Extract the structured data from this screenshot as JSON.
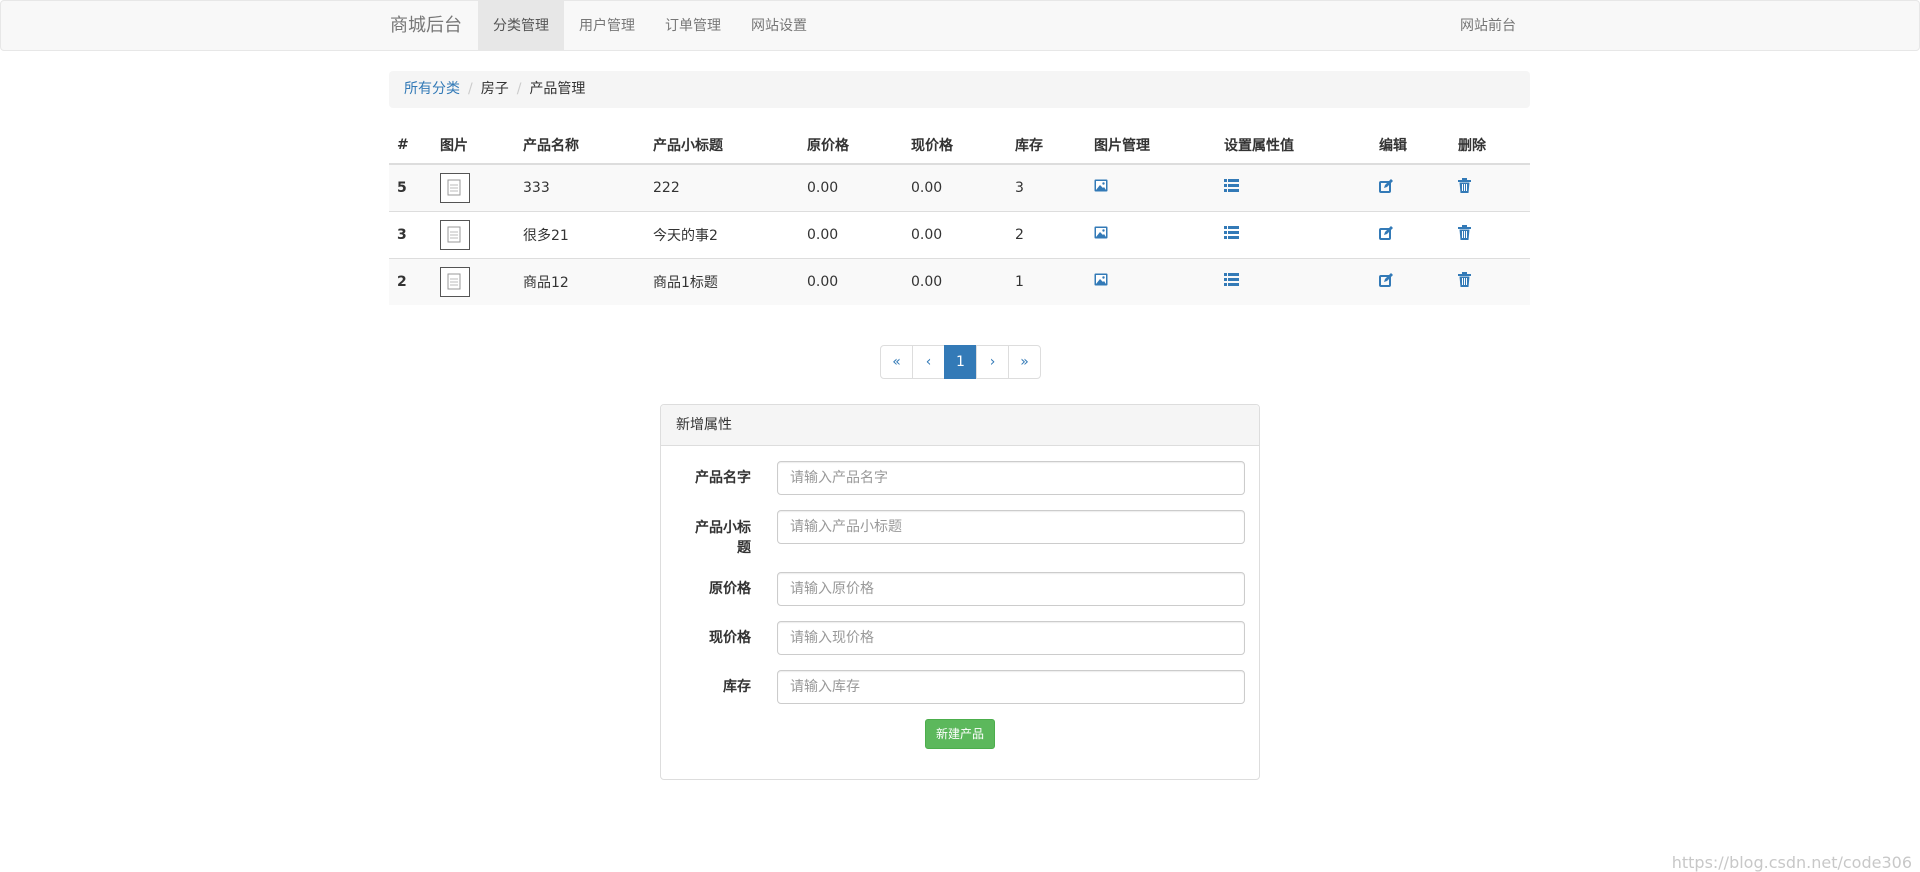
{
  "navbar": {
    "brand": "商城后台",
    "items": [
      {
        "label": "分类管理",
        "active": true
      },
      {
        "label": "用户管理",
        "active": false
      },
      {
        "label": "订单管理",
        "active": false
      },
      {
        "label": "网站设置",
        "active": false
      }
    ],
    "right_link": "网站前台"
  },
  "breadcrumb": {
    "items": [
      "所有分类",
      "房子",
      "产品管理"
    ]
  },
  "table": {
    "headers": [
      "#",
      "图片",
      "产品名称",
      "产品小标题",
      "原价格",
      "现价格",
      "库存",
      "图片管理",
      "设置属性值",
      "编辑",
      "删除"
    ],
    "rows": [
      {
        "id": "5",
        "name": "333",
        "subtitle": "222",
        "orig_price": "0.00",
        "price": "0.00",
        "stock": "3"
      },
      {
        "id": "3",
        "name": "很多21",
        "subtitle": "今天的事2",
        "orig_price": "0.00",
        "price": "0.00",
        "stock": "2"
      },
      {
        "id": "2",
        "name": "商品12",
        "subtitle": "商品1标题",
        "orig_price": "0.00",
        "price": "0.00",
        "stock": "1"
      }
    ]
  },
  "pagination": {
    "first": "«",
    "prev": "‹",
    "current": "1",
    "next": "›",
    "last": "»"
  },
  "form": {
    "title": "新增属性",
    "fields": [
      {
        "label": "产品名字",
        "placeholder": "请输入产品名字"
      },
      {
        "label_line1": "产品小标",
        "label_line2": "题",
        "placeholder": "请输入产品小标题"
      },
      {
        "label": "原价格",
        "placeholder": "请输入原价格"
      },
      {
        "label": "现价格",
        "placeholder": "请输入现价格"
      },
      {
        "label": "库存",
        "placeholder": "请输入库存"
      }
    ],
    "submit_label": "新建产品"
  },
  "watermark": "https://blog.csdn.net/code306",
  "colors": {
    "link": "#337ab7",
    "success": "#5cb85c",
    "nav_bg": "#f8f8f8"
  }
}
